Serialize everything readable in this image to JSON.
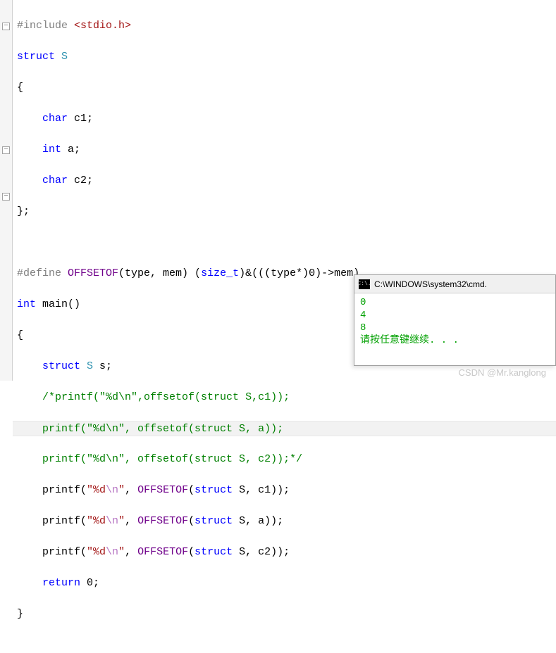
{
  "code": {
    "l1_pp": "#include",
    "l1_inc": " <stdio.h>",
    "l2_kw": "struct",
    "l2_name": " S",
    "l3": "{",
    "l4_kw": "char",
    "l4_rest": " c1;",
    "l5_kw": "int",
    "l5_rest": " a;",
    "l6_kw": "char",
    "l6_rest": " c2;",
    "l7": "};",
    "l8": "",
    "l9_pp": "#define",
    "l9_mac": " OFFSETOF",
    "l9_args": "(type, mem) (",
    "l9_type": "size_t",
    "l9_rest": ")&(((type*)0)->mem)",
    "l10_kw": "int",
    "l10_rest": " main()",
    "l11": "{",
    "l12_kw": "struct",
    "l12_type": " S",
    "l12_rest": " s;",
    "l13_a": "/*printf(\"%d\\n\",offsetof(struct S,c1));",
    "l14_a": "printf(\"%d\\n\", offsetof(struct S, a));",
    "l15_a": "printf(\"%d\\n\", offsetof(struct S, c2));*/",
    "l16_fn": "printf(",
    "l16_s1": "\"%d",
    "l16_esc": "\\n",
    "l16_s2": "\"",
    "l16_mid": ", ",
    "l16_mac": "OFFSETOF",
    "l16_args": "(",
    "l16_kw": "struct",
    "l16_end": " S, c1));",
    "l17_end": " S, a));",
    "l18_end": " S, c2));",
    "l19_kw": "return",
    "l19_rest": " 0;",
    "l20": "}"
  },
  "console": {
    "icon": "C:\\.",
    "title": "C:\\WINDOWS\\system32\\cmd.",
    "out1": "0",
    "out2": "4",
    "out3": "8",
    "prompt": "请按任意键继续. . ."
  },
  "watermark": "CSDN @Mr.kanglong",
  "fold_minus": "−"
}
